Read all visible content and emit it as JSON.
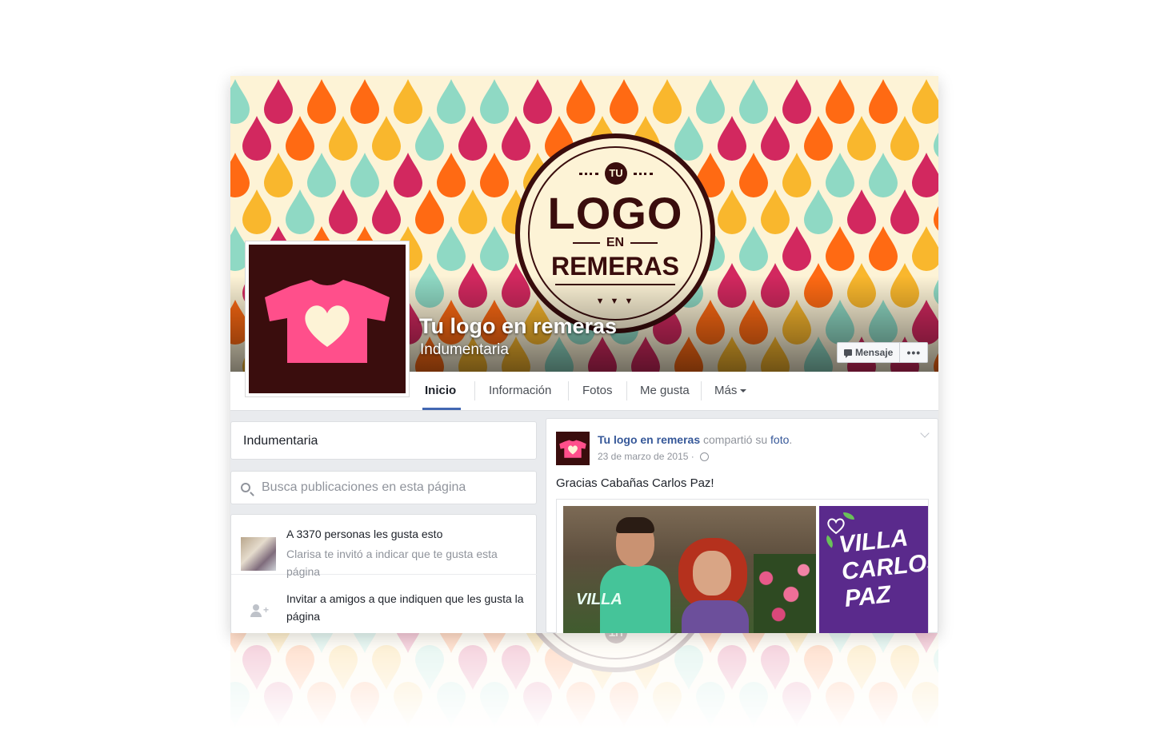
{
  "page": {
    "title": "Tu logo en remeras",
    "category": "Indumentaria"
  },
  "cover": {
    "emblem_top": "TU",
    "emblem_main": "LOGO",
    "emblem_mid": "EN",
    "emblem_bottom": "REMERAS",
    "colors": [
      "#8fd9c4",
      "#f9b72d",
      "#ff6a13",
      "#d2285f",
      "#fdf3d6"
    ]
  },
  "actions": {
    "message_label": "Mensaje",
    "more_label": "•••"
  },
  "nav": {
    "tabs": [
      {
        "label": "Inicio"
      },
      {
        "label": "Información"
      },
      {
        "label": "Fotos"
      },
      {
        "label": "Me gusta"
      },
      {
        "label": "Más"
      }
    ]
  },
  "sidebar": {
    "category": "Indumentaria",
    "search_placeholder": "Busca publicaciones en esta página",
    "likes_count_text": "A 3370 personas les gusta esto",
    "invited_text": "Clarisa te invitó a indicar que te gusta esta página",
    "invite_text": "Invitar a amigos a que indiquen que les gusta la página"
  },
  "post": {
    "author": "Tu logo en remeras",
    "action": "compartió su",
    "link": "foto",
    "date": "23 de marzo de 2015",
    "text": "Gracias Cabañas Carlos Paz!",
    "shirt_text": "VILLA",
    "side_text": "VILLA CARLOS PAZ"
  }
}
